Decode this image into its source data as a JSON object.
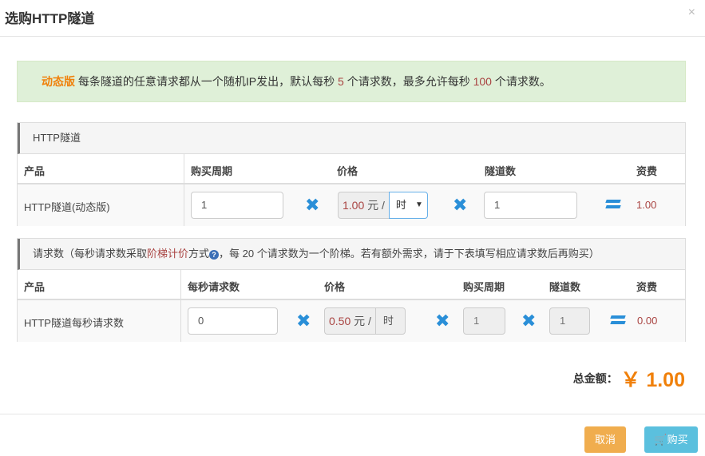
{
  "dialog": {
    "title": "选购HTTP隧道",
    "close": "×"
  },
  "alert": {
    "brand": "动态版",
    "text1": " 每条隧道的任意请求都从一个随机IP发出，默认每秒 ",
    "num1": "5",
    "text2": " 个请求数，最多允许每秒 ",
    "num2": "100",
    "text3": " 个请求数。"
  },
  "tunnel": {
    "heading": "HTTP隧道",
    "cols": {
      "product": "产品",
      "period": "购买周期",
      "price": "价格",
      "count": "隧道数",
      "fee": "资费"
    },
    "row": {
      "product": "HTTP隧道(动态版)",
      "period_value": "1",
      "price_value": "1.00",
      "price_suffix": "元 /",
      "unit": "时",
      "count_value": "1",
      "fee": "1.00"
    }
  },
  "requests": {
    "heading_pre": "请求数（每秒请求数采取",
    "heading_link": "阶梯计价",
    "heading_mid": "方式",
    "heading_post": "，每 20 个请求数为一个阶梯。若有额外需求，请于下表填写相应请求数后再购买）",
    "cols": {
      "product": "产品",
      "rps": "每秒请求数",
      "price": "价格",
      "period": "购买周期",
      "count": "隧道数",
      "fee": "资费"
    },
    "row": {
      "product": "HTTP隧道每秒请求数",
      "rps_value": "0",
      "price_value": "0.50",
      "price_suffix": "元 /",
      "unit": "时",
      "period_value": "1",
      "count_value": "1",
      "fee": "0.00"
    }
  },
  "total": {
    "label": "总金额：",
    "amount": "￥ 1.00"
  },
  "footer": {
    "cancel": "取消",
    "buy": "购买"
  },
  "colors": {
    "accent": "#f0800a",
    "primary_icon": "#2a8fd8",
    "price_red": "#a94442",
    "cancel_btn": "#f0ad4e",
    "buy_btn": "#5bc0de"
  }
}
